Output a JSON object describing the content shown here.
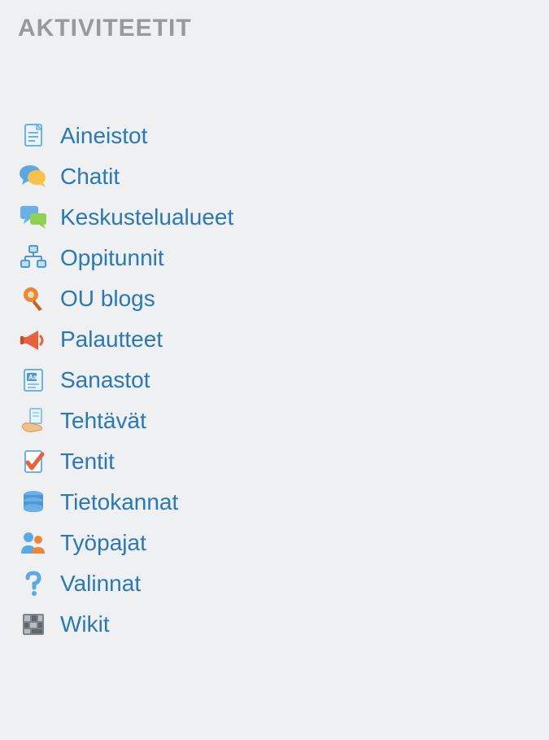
{
  "block": {
    "title": "AKTIVITEETIT",
    "items": [
      {
        "label": "Aineistot"
      },
      {
        "label": "Chatit"
      },
      {
        "label": "Keskustelualueet"
      },
      {
        "label": "Oppitunnit"
      },
      {
        "label": "OU blogs"
      },
      {
        "label": "Palautteet"
      },
      {
        "label": "Sanastot"
      },
      {
        "label": "Tehtävät"
      },
      {
        "label": "Tentit"
      },
      {
        "label": "Tietokannat"
      },
      {
        "label": "Työpajat"
      },
      {
        "label": "Valinnat"
      },
      {
        "label": "Wikit"
      }
    ]
  }
}
